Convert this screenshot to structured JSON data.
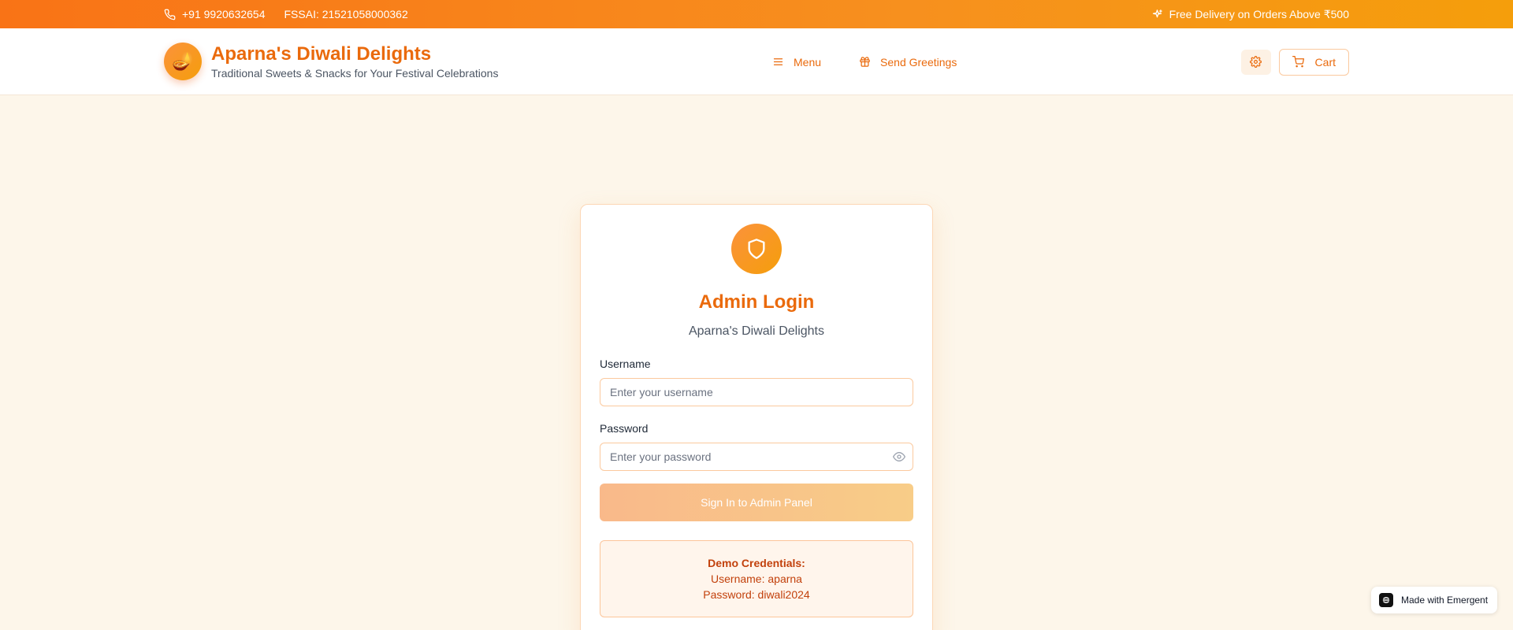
{
  "topbar": {
    "phone": "+91 9920632654",
    "fssai": "FSSAI: 21521058000362",
    "promo": "Free Delivery on Orders Above ₹500"
  },
  "header": {
    "title": "Aparna's Diwali Delights",
    "subtitle": "Traditional Sweets & Snacks for Your Festival Celebrations",
    "nav": {
      "menu": "Menu",
      "greetings": "Send Greetings"
    },
    "cart": "Cart"
  },
  "login": {
    "title": "Admin Login",
    "subtitle": "Aparna's Diwali Delights",
    "username_label": "Username",
    "username_placeholder": "Enter your username",
    "password_label": "Password",
    "password_placeholder": "Enter your password",
    "submit": "Sign In to Admin Panel",
    "demo": {
      "title": "Demo Credentials:",
      "username": "Username: aparna",
      "password": "Password: diwali2024"
    }
  },
  "badge": {
    "label": "Made with Emergent"
  },
  "icons": {
    "phone": "phone-icon",
    "sparkles": "sparkles-icon",
    "logo": "diya-icon",
    "menu": "menu-icon",
    "gift": "gift-icon",
    "settings": "gear-icon",
    "cart": "cart-icon",
    "shield": "shield-icon",
    "eye": "eye-icon"
  },
  "colors": {
    "accent": "#ea6a0c",
    "topbar_start": "#f97316",
    "topbar_end": "#f59e0b",
    "background": "#fdf6ea"
  }
}
